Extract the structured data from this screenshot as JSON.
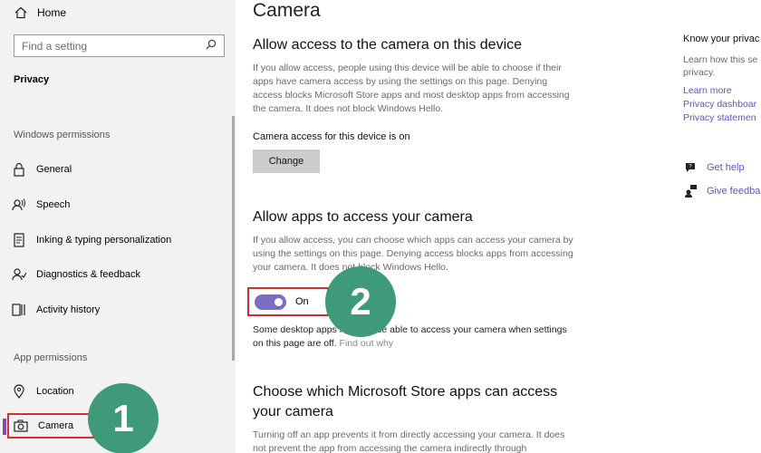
{
  "sidebar": {
    "home_label": "Home",
    "search_placeholder": "Find a setting",
    "privacy_label": "Privacy",
    "windows_permissions_label": "Windows permissions",
    "windows_items": [
      {
        "label": "General",
        "icon": "lock-icon"
      },
      {
        "label": "Speech",
        "icon": "speech-icon"
      },
      {
        "label": "Inking & typing personalization",
        "icon": "inking-icon"
      },
      {
        "label": "Diagnostics & feedback",
        "icon": "diagnostics-icon"
      },
      {
        "label": "Activity history",
        "icon": "activity-history-icon"
      }
    ],
    "app_permissions_label": "App permissions",
    "app_items": [
      {
        "label": "Location",
        "icon": "location-icon"
      },
      {
        "label": "Camera",
        "icon": "camera-icon",
        "selected": true
      }
    ]
  },
  "main": {
    "title": "Camera",
    "device_section": {
      "heading": "Allow access to the camera on this device",
      "description": "If you allow access, people using this device will be able to choose if their apps have camera access by using the settings on this page. Denying access blocks Microsoft Store apps and most desktop apps from accessing the camera. It does not block Windows Hello.",
      "status": "Camera access for this device is on",
      "change_button": "Change"
    },
    "apps_section": {
      "heading": "Allow apps to access your camera",
      "description": "If you allow access, you can choose which apps can access your camera by using the settings on this page. Denying access blocks apps from accessing your camera. It does not block Windows Hello.",
      "toggle_state": "On",
      "toggle_on": true,
      "note": "Some desktop apps may still be able to access your camera when settings on this page are off.",
      "note_link": "Find out why"
    },
    "store_section": {
      "heading_line1": "Choose which Microsoft Store apps can access",
      "heading_line2": "your camera",
      "description": "Turning off an app prevents it from directly accessing your camera. It does not prevent the app from accessing the camera indirectly through"
    }
  },
  "right_panel": {
    "title": "Know your privac",
    "text_line1": "Learn how this se",
    "text_line2": "privacy.",
    "links": [
      "Learn more",
      "Privacy dashboar",
      "Privacy statemen"
    ],
    "help_label": "Get help",
    "feedback_label": "Give feedba"
  },
  "annotations": {
    "step1": "1",
    "step2": "2",
    "color": "#3f9a7a",
    "highlight_color": "#d32f2f"
  },
  "colors": {
    "accent": "#7b6cc4",
    "link": "#5b56b8",
    "sidebar_bg": "#f2f2f2"
  }
}
